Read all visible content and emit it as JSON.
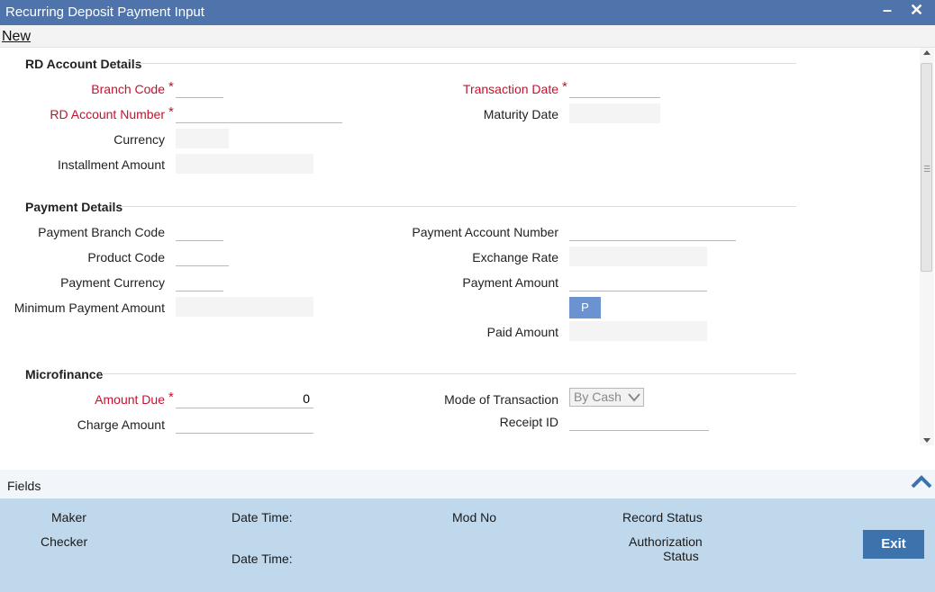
{
  "window": {
    "title": "Recurring Deposit Payment Input",
    "minimize_label": "–",
    "close_label": "✕"
  },
  "menu": {
    "new_label": "New"
  },
  "rd_account": {
    "section_title": "RD Account Details",
    "branch_code_label": "Branch Code",
    "rd_account_number_label": "RD Account Number",
    "currency_label": "Currency",
    "installment_amount_label": "Installment Amount",
    "transaction_date_label": "Transaction Date",
    "maturity_date_label": "Maturity Date",
    "branch_code": "",
    "rd_account_number": "",
    "currency": "",
    "installment_amount": "",
    "transaction_date": "",
    "maturity_date": ""
  },
  "payment": {
    "section_title": "Payment Details",
    "payment_branch_code_label": "Payment Branch Code",
    "product_code_label": "Product Code",
    "payment_currency_label": "Payment Currency",
    "minimum_payment_amount_label": "Minimum Payment Amount",
    "payment_account_number_label": "Payment Account Number",
    "exchange_rate_label": "Exchange Rate",
    "payment_amount_label": "Payment Amount",
    "p_button_label": "P",
    "paid_amount_label": "Paid Amount",
    "payment_branch_code": "",
    "product_code": "",
    "payment_currency": "",
    "minimum_payment_amount": "",
    "payment_account_number": "",
    "exchange_rate": "",
    "payment_amount": "",
    "paid_amount": ""
  },
  "microfinance": {
    "section_title": "Microfinance",
    "amount_due_label": "Amount Due",
    "charge_amount_label": "Charge Amount",
    "mode_of_transaction_label": "Mode of Transaction",
    "receipt_id_label": "Receipt ID",
    "amount_due": "0",
    "charge_amount": "",
    "mode_of_transaction": "By Cash",
    "receipt_id": ""
  },
  "required_marker": "*",
  "footer": {
    "fields_label": "Fields",
    "maker_label": "Maker",
    "checker_label": "Checker",
    "date_time_label": "Date Time:",
    "mod_no_label": "Mod No",
    "record_status_label": "Record Status",
    "authorization_label": "Authorization",
    "status_label": "Status",
    "exit_label": "Exit"
  },
  "colors": {
    "title_bar": "#4f74ac",
    "required": "#c8102e",
    "audit_panel": "#bfd8ec",
    "exit_button": "#3c73ad"
  },
  "icons": [
    "minimize-icon",
    "close-icon",
    "chevron-down-icon",
    "chevron-up-icon",
    "scroll-up-icon",
    "scroll-down-icon"
  ]
}
